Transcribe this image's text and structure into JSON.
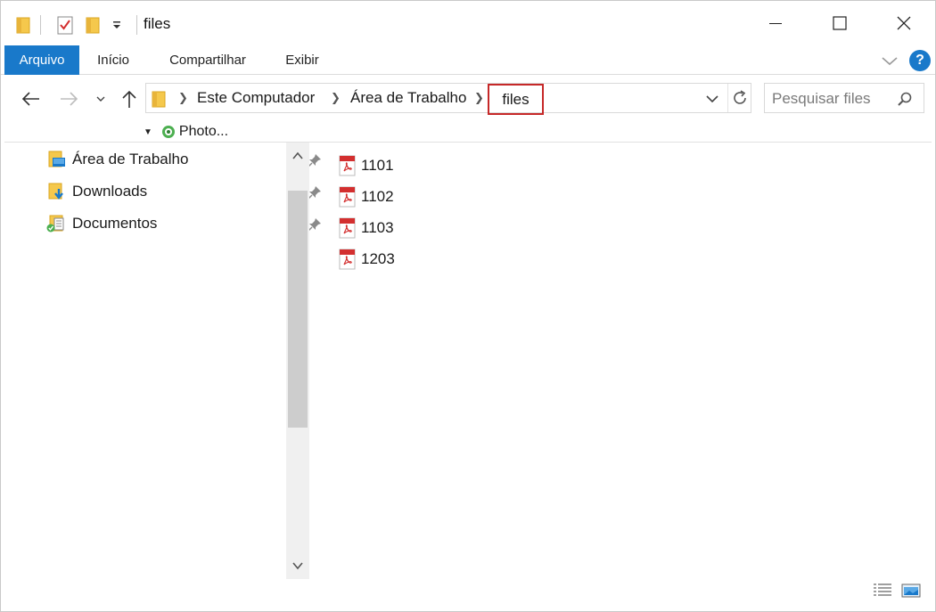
{
  "window": {
    "title": "files",
    "quick_access": {
      "icons": [
        "folder-icon",
        "properties-icon",
        "new-folder-icon",
        "customize-dropdown-icon"
      ]
    },
    "controls": [
      "minimize-icon",
      "maximize-icon",
      "close-icon"
    ]
  },
  "ribbon": {
    "tabs": [
      {
        "label": "Arquivo",
        "active": true
      },
      {
        "label": "Início"
      },
      {
        "label": "Compartilhar"
      },
      {
        "label": "Exibir"
      }
    ],
    "help_label": "?"
  },
  "navigation": {
    "breadcrumb": [
      "Este Computador",
      "Área de Trabalho"
    ],
    "current": "files",
    "search_placeholder": "Pesquisar files"
  },
  "extra_toolbar": {
    "label": "Photo..."
  },
  "nav_pane": {
    "items": [
      {
        "label": "Área de Trabalho",
        "icon": "desktop-icon",
        "pinned": true
      },
      {
        "label": "Downloads",
        "icon": "downloads-icon",
        "pinned": true
      },
      {
        "label": "Documentos",
        "icon": "documents-icon",
        "pinned": true
      }
    ]
  },
  "files": [
    {
      "name": "1101",
      "icon": "pdf-icon"
    },
    {
      "name": "1102",
      "icon": "pdf-icon"
    },
    {
      "name": "1103",
      "icon": "pdf-icon"
    },
    {
      "name": "1203",
      "icon": "pdf-icon"
    }
  ],
  "colors": {
    "accent": "#1979ca",
    "highlight_box": "#c62828",
    "folder": "#f5c84c",
    "pdf_red": "#d32f2f"
  }
}
